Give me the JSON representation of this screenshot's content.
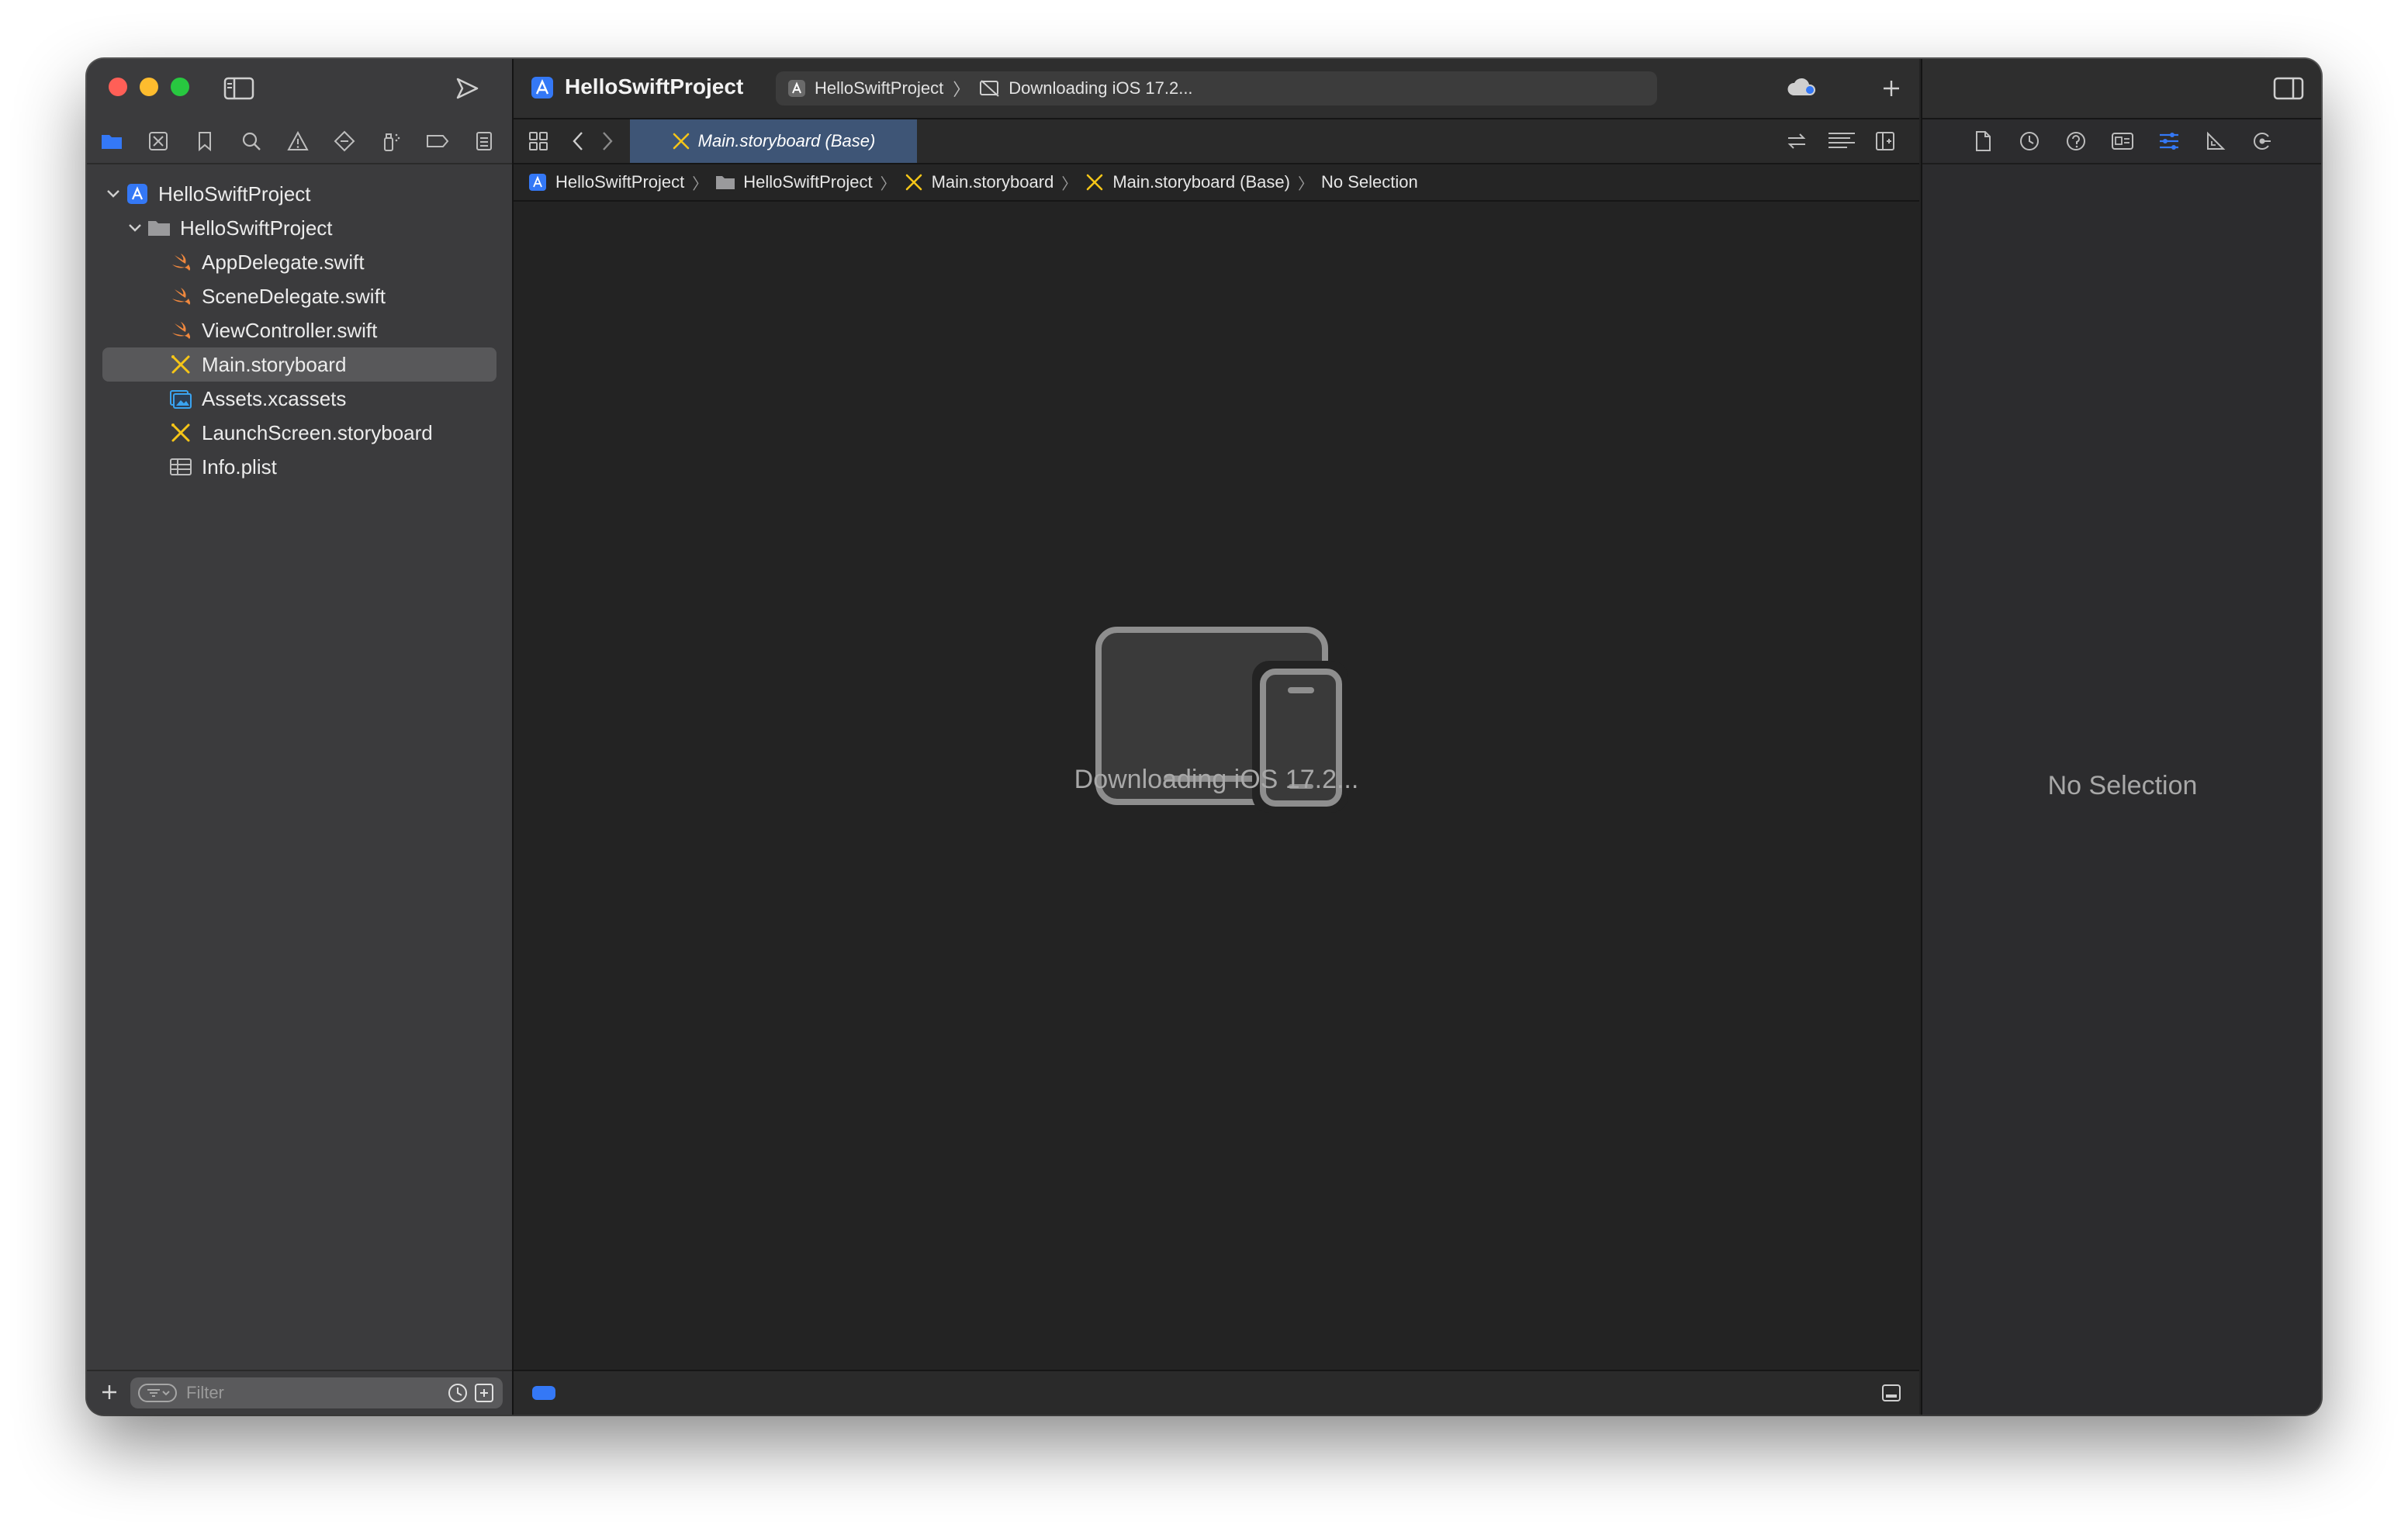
{
  "window": {
    "project_title": "HelloSwiftProject"
  },
  "activity": {
    "scheme": "HelloSwiftProject",
    "destination": "Downloading iOS 17.2..."
  },
  "navigator": {
    "tree": [
      {
        "label": "HelloSwiftProject",
        "icon": "project-icon",
        "level": 0,
        "expanded": true
      },
      {
        "label": "HelloSwiftProject",
        "icon": "folder-icon",
        "level": 1,
        "expanded": true
      },
      {
        "label": "AppDelegate.swift",
        "icon": "swift-file-icon",
        "level": 2
      },
      {
        "label": "SceneDelegate.swift",
        "icon": "swift-file-icon",
        "level": 2
      },
      {
        "label": "ViewController.swift",
        "icon": "swift-file-icon",
        "level": 2
      },
      {
        "label": "Main.storyboard",
        "icon": "storyboard-icon",
        "level": 2,
        "selected": true
      },
      {
        "label": "Assets.xcassets",
        "icon": "asset-catalog-icon",
        "level": 2
      },
      {
        "label": "LaunchScreen.storyboard",
        "icon": "storyboard-icon",
        "level": 2
      },
      {
        "label": "Info.plist",
        "icon": "plist-icon",
        "level": 2
      }
    ],
    "filter_placeholder": "Filter"
  },
  "editor": {
    "active_tab": "Main.storyboard (Base)",
    "jumpbar": [
      "HelloSwiftProject",
      "HelloSwiftProject",
      "Main.storyboard",
      "Main.storyboard (Base)",
      "No Selection"
    ],
    "status_message": "Downloading iOS 17.2..."
  },
  "inspector": {
    "empty_message": "No Selection"
  },
  "colors": {
    "accent": "#3478f6",
    "swift": "#f0883e",
    "storyboard": "#f5c518",
    "selection": "#58585a"
  }
}
